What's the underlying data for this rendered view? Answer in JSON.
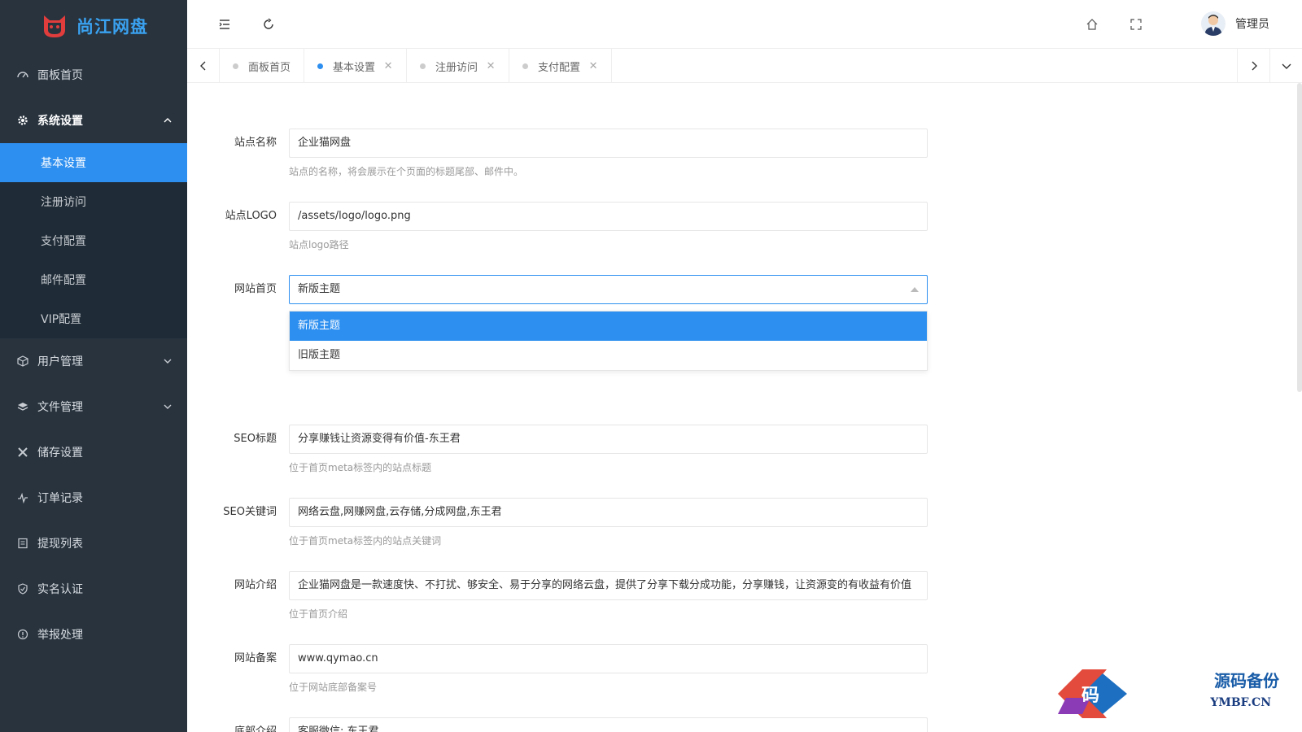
{
  "brand": {
    "name": "尚江网盘",
    "icon": "cat-logo-icon"
  },
  "sidebar": {
    "items": [
      {
        "label": "面板首页",
        "icon": "dashboard-icon"
      },
      {
        "label": "系统设置",
        "icon": "gear-icon",
        "expanded": true,
        "children": [
          "基本设置",
          "注册访问",
          "支付配置",
          "邮件配置",
          "VIP配置"
        ],
        "active_child": "基本设置"
      },
      {
        "label": "用户管理",
        "icon": "cube-icon",
        "expanded": false
      },
      {
        "label": "文件管理",
        "icon": "layers-icon",
        "expanded": false
      },
      {
        "label": "储存设置",
        "icon": "tools-icon"
      },
      {
        "label": "订单记录",
        "icon": "pulse-icon"
      },
      {
        "label": "提现列表",
        "icon": "list-icon"
      },
      {
        "label": "实名认证",
        "icon": "shield-check-icon"
      },
      {
        "label": "举报处理",
        "icon": "info-circle-icon"
      }
    ]
  },
  "header": {
    "user_name": "管理员"
  },
  "tabs": [
    {
      "label": "面板首页",
      "closable": false,
      "active": false
    },
    {
      "label": "基本设置",
      "closable": true,
      "active": true
    },
    {
      "label": "注册访问",
      "closable": true,
      "active": false
    },
    {
      "label": "支付配置",
      "closable": true,
      "active": false
    }
  ],
  "form": {
    "site_name": {
      "label": "站点名称",
      "value": "企业猫网盘",
      "hint": "站点的名称，将会展示在个页面的标题尾部、邮件中。"
    },
    "site_logo": {
      "label": "站点LOGO",
      "value": "/assets/logo/logo.png",
      "hint": "站点logo路径"
    },
    "home": {
      "label": "网站首页",
      "value": "新版主题",
      "options": [
        "新版主题",
        "旧版主题"
      ]
    },
    "seo_title": {
      "label": "SEO标题",
      "value": "分享赚钱让资源变得有价值-东王君",
      "hint": "位于首页meta标签内的站点标题"
    },
    "seo_keywords": {
      "label": "SEO关键词",
      "value": "网络云盘,网赚网盘,云存储,分成网盘,东王君",
      "hint": "位于首页meta标签内的站点关键词"
    },
    "intro": {
      "label": "网站介绍",
      "value": "企业猫网盘是一款速度快、不打扰、够安全、易于分享的网络云盘，提供了分享下载分成功能，分享赚钱，让资源变的有收益有价值",
      "hint": "位于首页介绍"
    },
    "icp": {
      "label": "网站备案",
      "value": "www.qymao.cn",
      "hint": "位于网站底部备案号"
    },
    "footer": {
      "label": "底部介绍",
      "value": "客服微信: 东王君"
    }
  },
  "watermark": {
    "line1": "源码备份",
    "line2": "YMBF.CN",
    "badge": "码"
  },
  "colors": {
    "sidebar_bg": "#28333e",
    "submenu_bg": "#1f2b36",
    "accent": "#2d8ff0",
    "brand": "#3aa2f0"
  }
}
